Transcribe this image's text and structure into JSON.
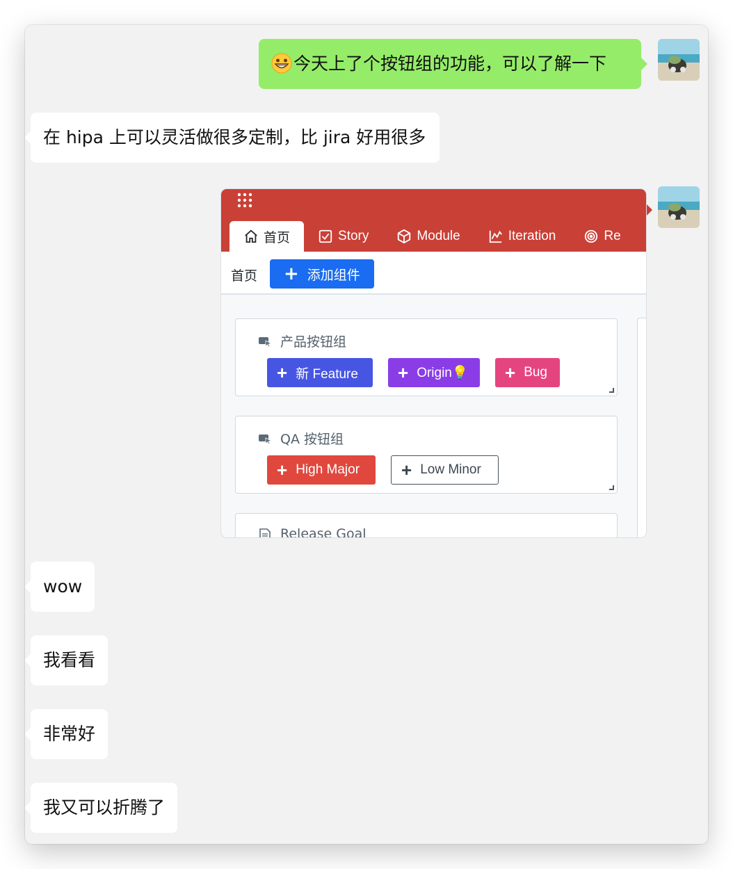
{
  "messages": [
    {
      "from": "me",
      "text": "今天上了个按钮组的功能，可以了解一下",
      "emoji": "grinning-face"
    },
    {
      "from": "other",
      "text": "在 hipa 上可以灵活做很多定制，比 jira 好用很多"
    },
    {
      "from": "other",
      "text": "wow"
    },
    {
      "from": "other",
      "text": "我看看"
    },
    {
      "from": "other",
      "text": "非常好"
    },
    {
      "from": "other",
      "text": "我又可以折腾了"
    }
  ],
  "screenshot": {
    "tabs": [
      {
        "label": "首页",
        "icon": "home-icon"
      },
      {
        "label": "Story",
        "icon": "checkbox-icon"
      },
      {
        "label": "Module",
        "icon": "cube-icon"
      },
      {
        "label": "Iteration",
        "icon": "chart-icon"
      },
      {
        "label": "Re",
        "icon": "target-icon"
      }
    ],
    "subbar": {
      "home": "首页",
      "add_button": "添加组件"
    },
    "panels": [
      {
        "title": "产品按钮组",
        "buttons": [
          {
            "label": "新 Feature",
            "color": "#4756e2"
          },
          {
            "label": "Origin💡",
            "color": "#8a3de6"
          },
          {
            "label": "Bug",
            "color": "#e5457f"
          }
        ]
      },
      {
        "title": "QA 按钮组",
        "buttons": [
          {
            "label": "High Major",
            "color": "#e0483e"
          },
          {
            "label": "Low Minor",
            "color": "outline"
          }
        ]
      },
      {
        "title": "Release Goal"
      }
    ],
    "colors": {
      "topbar": "#c94037",
      "primary": "#1a6cf1"
    }
  },
  "colors": {
    "me_bubble": "#95ec69",
    "other_bubble": "#ffffff",
    "background": "#f2f2f2"
  }
}
